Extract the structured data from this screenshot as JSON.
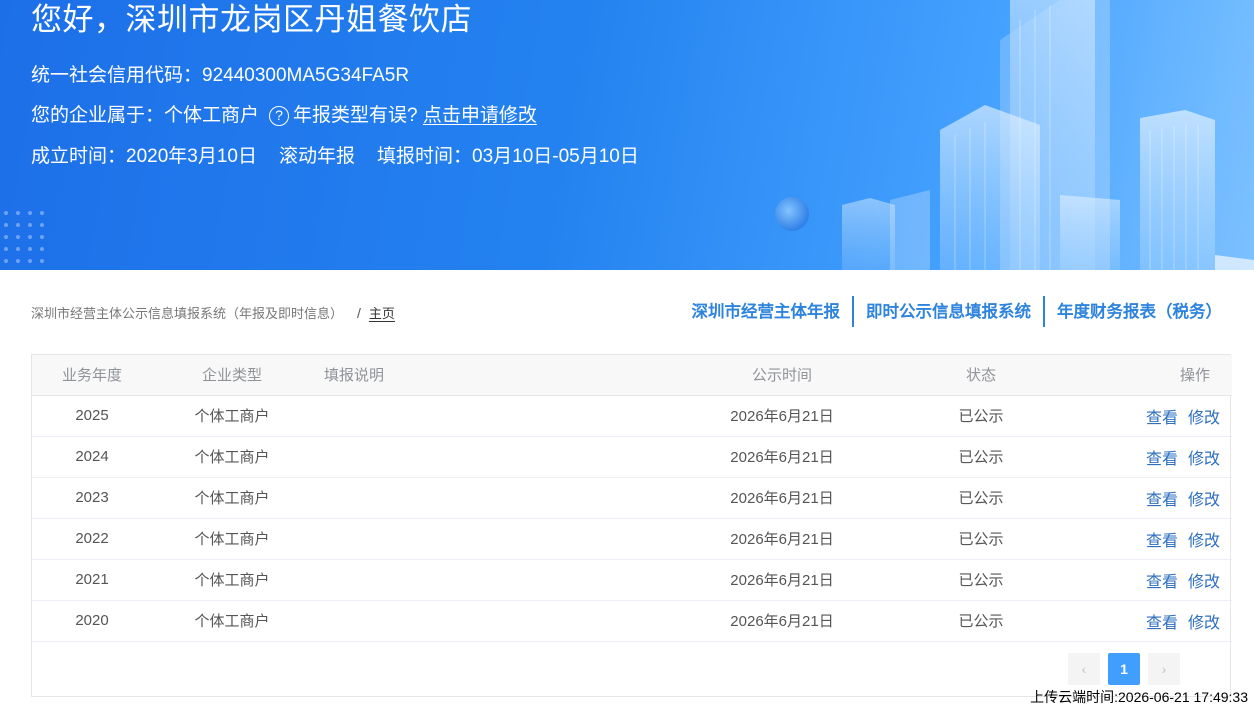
{
  "banner": {
    "greeting": "您好，深圳市龙岗区丹姐餐饮店",
    "credit_code_label": "统一社会信用代码：",
    "credit_code": "92440300MA5G34FA5R",
    "enterprise_type_label": "您的企业属于：",
    "enterprise_type": "个体工商户",
    "type_error_text": "年报类型有误?",
    "apply_link": "点击申请修改",
    "established_label": "成立时间：",
    "established_date": "2020年3月10日",
    "rolling_report": "滚动年报",
    "fill_time_label": "填报时间：",
    "fill_time": "03月10日-05月10日"
  },
  "breadcrumb": {
    "system": "深圳市经营主体公示信息填报系统（年报及即时信息）",
    "separator": "/",
    "home": "主页"
  },
  "top_links": [
    "深圳市经营主体年报",
    "即时公示信息填报系统",
    "年度财务报表（税务）"
  ],
  "table": {
    "headers": {
      "year": "业务年度",
      "type": "企业类型",
      "desc": "填报说明",
      "time": "公示时间",
      "status": "状态",
      "ops": "操作"
    },
    "rows": [
      {
        "year": "2025",
        "type": "个体工商户",
        "desc": "",
        "time": "2026年6月21日",
        "status": "已公示",
        "view": "查看",
        "edit": "修改"
      },
      {
        "year": "2024",
        "type": "个体工商户",
        "desc": "",
        "time": "2026年6月21日",
        "status": "已公示",
        "view": "查看",
        "edit": "修改"
      },
      {
        "year": "2023",
        "type": "个体工商户",
        "desc": "",
        "time": "2026年6月21日",
        "status": "已公示",
        "view": "查看",
        "edit": "修改"
      },
      {
        "year": "2022",
        "type": "个体工商户",
        "desc": "",
        "time": "2026年6月21日",
        "status": "已公示",
        "view": "查看",
        "edit": "修改"
      },
      {
        "year": "2021",
        "type": "个体工商户",
        "desc": "",
        "time": "2026年6月21日",
        "status": "已公示",
        "view": "查看",
        "edit": "修改"
      },
      {
        "year": "2020",
        "type": "个体工商户",
        "desc": "",
        "time": "2026年6月21日",
        "status": "已公示",
        "view": "查看",
        "edit": "修改"
      }
    ]
  },
  "pagination": {
    "prev_icon": "chevron-left-icon",
    "current_page": "1",
    "next_icon": "chevron-right-icon"
  },
  "upload_time": "上传云端时间:2026-06-21 17:49:33",
  "colors": {
    "banner_blue": "#2482f0",
    "link_blue": "#2e84dc",
    "page_active": "#409eff"
  }
}
